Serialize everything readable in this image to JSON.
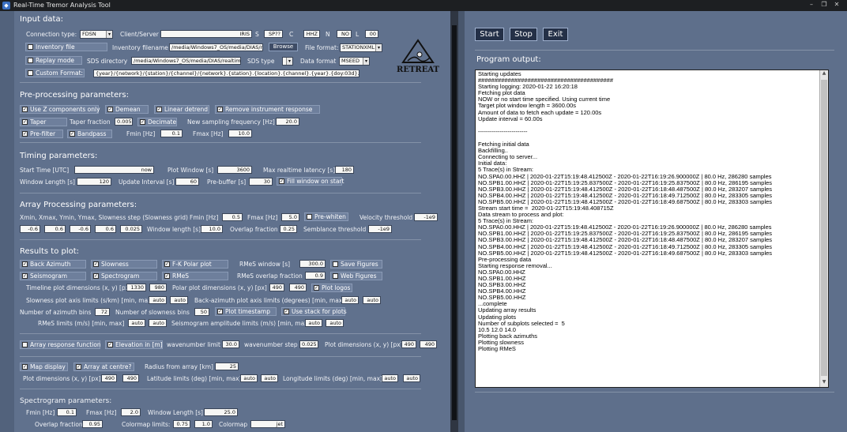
{
  "window": {
    "title": "Real-Time Tremor Analysis Tool",
    "min": "–",
    "restore": "❐",
    "close": "✕"
  },
  "logo": {
    "text": "RETREAT"
  },
  "input": {
    "title": "Input data:",
    "connection_type_label": "Connection type:",
    "connection_type": "FDSN",
    "client_label": "Client/Server",
    "client": "IRIS",
    "s_label": "S",
    "s": "SP??",
    "c_label": "C",
    "c": "HHZ",
    "n_label": "N",
    "n": "NO",
    "l_label": "L",
    "l": "00",
    "inventory_file": "Inventory file",
    "inventory_filename_label": "Inventory filename",
    "inventory_filename": "/media/Windows7_OS/media/DIAS/rea",
    "browse": "Browse",
    "file_format_label": "File format:",
    "file_format": "STATIONXML",
    "replay_mode": "Replay mode",
    "sds_dir_label": "SDS directory",
    "sds_dir": "/media/Windows7_OS/media/DIAS/realtime/r",
    "sds_type_label": "SDS type",
    "data_format_label": "Data format",
    "data_format": "MSEED",
    "custom_format": "Custom Format:",
    "custom_format_value": "{year}/{network}/{station}/{channel}/{network}.{station}.{location}.{channel}.{year}.{doy:03d}.00.00.mseed"
  },
  "pre": {
    "title": "Pre-processing parameters:",
    "use_z": "Use Z components only",
    "demean": "Demean",
    "linear_detrend": "Linear detrend",
    "remove_resp": "Remove instrument response",
    "taper": "Taper",
    "taper_fraction_label": "Taper fraction",
    "taper_fraction": "0.005",
    "decimate": "Decimate",
    "new_rate_label": "New sampling frequency [Hz]",
    "new_rate": "20.0",
    "prefilter": "Pre-filter",
    "bandpass": "Bandpass",
    "fmin_label": "Fmin [Hz]",
    "fmin": "0.1",
    "fmax_label": "Fmax [Hz]",
    "fmax": "10.0"
  },
  "timing": {
    "title": "Timing parameters:",
    "start_label": "Start Time [UTC]",
    "start": "now",
    "plot_window_label": "Plot Window [s]",
    "plot_window": "3600",
    "max_latency_label": "Max realtime latency [s]",
    "max_latency": "180",
    "window_length_label": "Window Length [s]",
    "window_length": "120",
    "update_interval_label": "Update Interval [s]",
    "update_interval": "60",
    "prebuffer_label": "Pre-buffer [s]",
    "prebuffer": "30",
    "fill_window": "Fill window on start"
  },
  "array": {
    "title": "Array Processing parameters:",
    "grid_label": "Xmin, Xmax, Ymin, Ymax, Slowness step (Slowness grid)",
    "fmin_label": "Fmin [Hz]",
    "fmin": "0.5",
    "fmax_label": "Fmax [Hz]",
    "fmax": "5.0",
    "prewhiten": "Pre-whiten",
    "vel_threshold_label": "Velocity threshold",
    "vel_threshold": "-1e9",
    "xmin": "-0.6",
    "xmax": "0.6",
    "ymin": "-0.6",
    "ymax": "0.6",
    "step": "0.025",
    "window_length_label": "Window length [s]",
    "window_length": "10.0",
    "overlap_label": "Overlap fraction",
    "overlap": "0.25",
    "semblance_label": "Semblance threshold",
    "semblance": "-1e9"
  },
  "results": {
    "title": "Results to plot:",
    "back_azimuth": "Back Azimuth",
    "slowness": "Slowness",
    "fk_polar": "F-K Polar plot",
    "rmes_window_label": "RMeS window [s]",
    "rmes_window": "300.0",
    "save_figures": "Save Figures",
    "seismogram": "Seismogram",
    "spectrogram": "Spectrogram",
    "rmes": "RMeS",
    "rmes_overlap_label": "RMeS overlap fraction",
    "rmes_overlap": "0.9",
    "web_figures": "Web Figures",
    "timeline_dims_label": "Timeline plot dimensions (x, y) [px]",
    "timeline_x": "1330",
    "timeline_y": "980",
    "polar_dims_label": "Polar plot dimensions (x, y) [px]",
    "polar_x": "490",
    "polar_y": "490",
    "plot_logos": "Plot logos",
    "slowness_limits_label": "Slowness plot axis limits (s/km) [min, max]",
    "slow_min": "auto",
    "slow_max": "auto",
    "baz_limits_label": "Back-azimuth plot axis limits (degrees) [min, max]",
    "baz_min": "auto",
    "baz_max": "auto",
    "az_bins_label": "Number of azimuth bins",
    "az_bins": "72",
    "slow_bins_label": "Number of slowness bins",
    "slow_bins": "50",
    "plot_timestamp": "Plot timestamp",
    "use_stack": "Use stack for plots",
    "rmes_limits_label": "RMeS limits (m/s) [min, max]",
    "rmes_min": "auto",
    "rmes_max": "auto",
    "seis_limits_label": "Seismogram amplitude limits (m/s) [min, max]",
    "seis_min": "auto",
    "seis_max": "auto"
  },
  "arf": {
    "array_response": "Array response function",
    "elevation": "Elevation in [m]",
    "wn_limit_label": "wavenumber limit",
    "wn_limit": "30.0",
    "wn_step_label": "wavenumber step",
    "wn_step": "0.025",
    "plot_dims_label": "Plot dimensions (x, y) [px]",
    "plot_x": "490",
    "plot_y": "490"
  },
  "map": {
    "map_display": "Map display",
    "array_centre": "Array at centre?",
    "radius_label": "Radius from array [km]",
    "radius": "25",
    "plot_dims_label": "Plot dimensions (x, y) [px]",
    "plot_x": "490",
    "plot_y": "490",
    "lat_label": "Latitude limits (deg) [min, max]",
    "lat_min": "auto",
    "lat_max": "auto",
    "lon_label": "Longitude limits (deg) [min, max]",
    "lon_min": "auto",
    "lon_max": "auto"
  },
  "spec": {
    "title": "Spectrogram parameters:",
    "fmin_label": "Fmin [Hz]",
    "fmin": "0.1",
    "fmax_label": "Fmax [Hz]",
    "fmax": "2.0",
    "window_label": "Window Length [s]",
    "window": "25.0",
    "overlap_label": "Overlap fraction",
    "overlap": "0.95",
    "clim_label": "Colormap limits:",
    "clim_min": "0.75",
    "clim_max": "1.0",
    "cmap_label": "Colormap",
    "cmap": "jet"
  },
  "controls": {
    "start": "Start",
    "stop": "Stop",
    "exit": "Exit"
  },
  "output": {
    "title": "Program output:",
    "lines": [
      "Starting updates",
      "#########################################",
      "Starting logging: 2020-01-22 16:20:18",
      "Fetching plot data",
      "NOW or no start time specified. Using current time",
      "Target plot window length = 3600.00s",
      "Amount of data to fetch each update = 120.00s",
      "Update interval = 60.00s",
      "",
      "-------------------------",
      "",
      "Fetching initial data",
      "Backfilling..",
      "Connecting to server...",
      "Initial data:",
      "5 Trace(s) in Stream:",
      "NO.SPA0.00.HHZ | 2020-01-22T15:19:48.412500Z - 2020-01-22T16:19:26.900000Z | 80.0 Hz, 286280 samples",
      "NO.SPB1.00.HHZ | 2020-01-22T15:19:25.837500Z - 2020-01-22T16:19:25.837500Z | 80.0 Hz, 286195 samples",
      "NO.SPB3.00.HHZ | 2020-01-22T15:19:48.412500Z - 2020-01-22T16:18:48.487500Z | 80.0 Hz, 283207 samples",
      "NO.SPB4.00.HHZ | 2020-01-22T15:19:48.412500Z - 2020-01-22T16:18:49.712500Z | 80.0 Hz, 283305 samples",
      "NO.SPB5.00.HHZ | 2020-01-22T15:19:48.412500Z - 2020-01-22T16:18:49.687500Z | 80.0 Hz, 283303 samples",
      "Stream start time =  2020-01-22T15:19:48.408715Z",
      "Data stream to process and plot:",
      "5 Trace(s) in Stream:",
      "NO.SPA0.00.HHZ | 2020-01-22T15:19:48.412500Z - 2020-01-22T16:19:26.900000Z | 80.0 Hz, 286280 samples",
      "NO.SPB1.00.HHZ | 2020-01-22T15:19:25.837500Z - 2020-01-22T16:19:25.837500Z | 80.0 Hz, 286195 samples",
      "NO.SPB3.00.HHZ | 2020-01-22T15:19:48.412500Z - 2020-01-22T16:18:48.487500Z | 80.0 Hz, 283207 samples",
      "NO.SPB4.00.HHZ | 2020-01-22T15:19:48.412500Z - 2020-01-22T16:18:49.712500Z | 80.0 Hz, 283305 samples",
      "NO.SPB5.00.HHZ | 2020-01-22T15:19:48.412500Z - 2020-01-22T16:18:49.687500Z | 80.0 Hz, 283303 samples",
      "Pre-processing data",
      "Starting response removal...",
      "NO.SPA0.00.HHZ",
      "NO.SPB1.00.HHZ",
      "NO.SPB3.00.HHZ",
      "NO.SPB4.00.HHZ",
      "NO.SPB5.00.HHZ",
      "...complete",
      "Updating array results",
      "Updating plots",
      "Number of subplots selected =  5",
      "10.5 12.0 14.0",
      "Plotting back azimuths",
      "Plotting slowness",
      "Plotting RMeS"
    ]
  }
}
